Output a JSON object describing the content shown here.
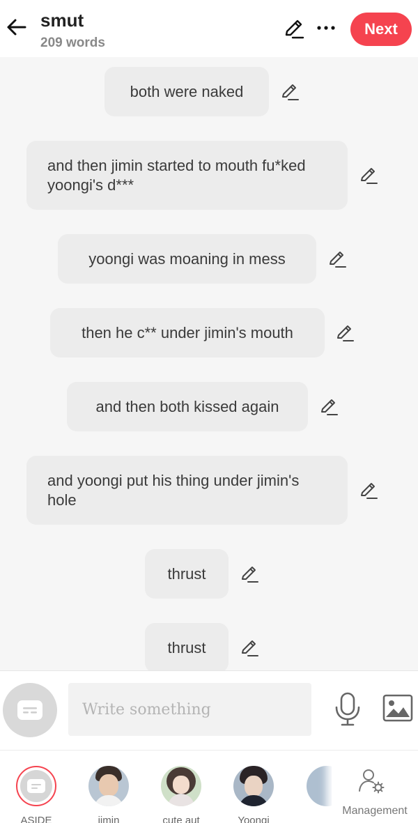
{
  "header": {
    "title": "smut",
    "word_count": "209 words",
    "next_label": "Next",
    "icons": {
      "back": "arrow-left-icon",
      "edit": "pencil-icon",
      "more": "more-horizontal-icon"
    }
  },
  "messages": [
    {
      "text": "both were naked"
    },
    {
      "text": "and then jimin started to mouth fu*ked yoongi's d***"
    },
    {
      "text": "yoongi was moaning in mess"
    },
    {
      "text": "then he c** under jimin's mouth"
    },
    {
      "text": "and then both kissed again"
    },
    {
      "text": "and yoongi put his thing under jimin's hole"
    },
    {
      "text": "thrust"
    },
    {
      "text": "thrust"
    }
  ],
  "input": {
    "placeholder": "Write something",
    "value": "",
    "icons": {
      "aside": "chat-bubble-icon",
      "mic": "microphone-icon",
      "image": "image-icon"
    }
  },
  "characters": [
    {
      "label": "ASIDE",
      "selected": true
    },
    {
      "label": "jimin"
    },
    {
      "label": "cute aut"
    },
    {
      "label": "Yoongi"
    }
  ],
  "management": {
    "label": "Management",
    "icon": "user-settings-icon"
  },
  "colors": {
    "accent": "#f5434f",
    "bubble": "#ececec",
    "background": "#f6f6f6"
  }
}
